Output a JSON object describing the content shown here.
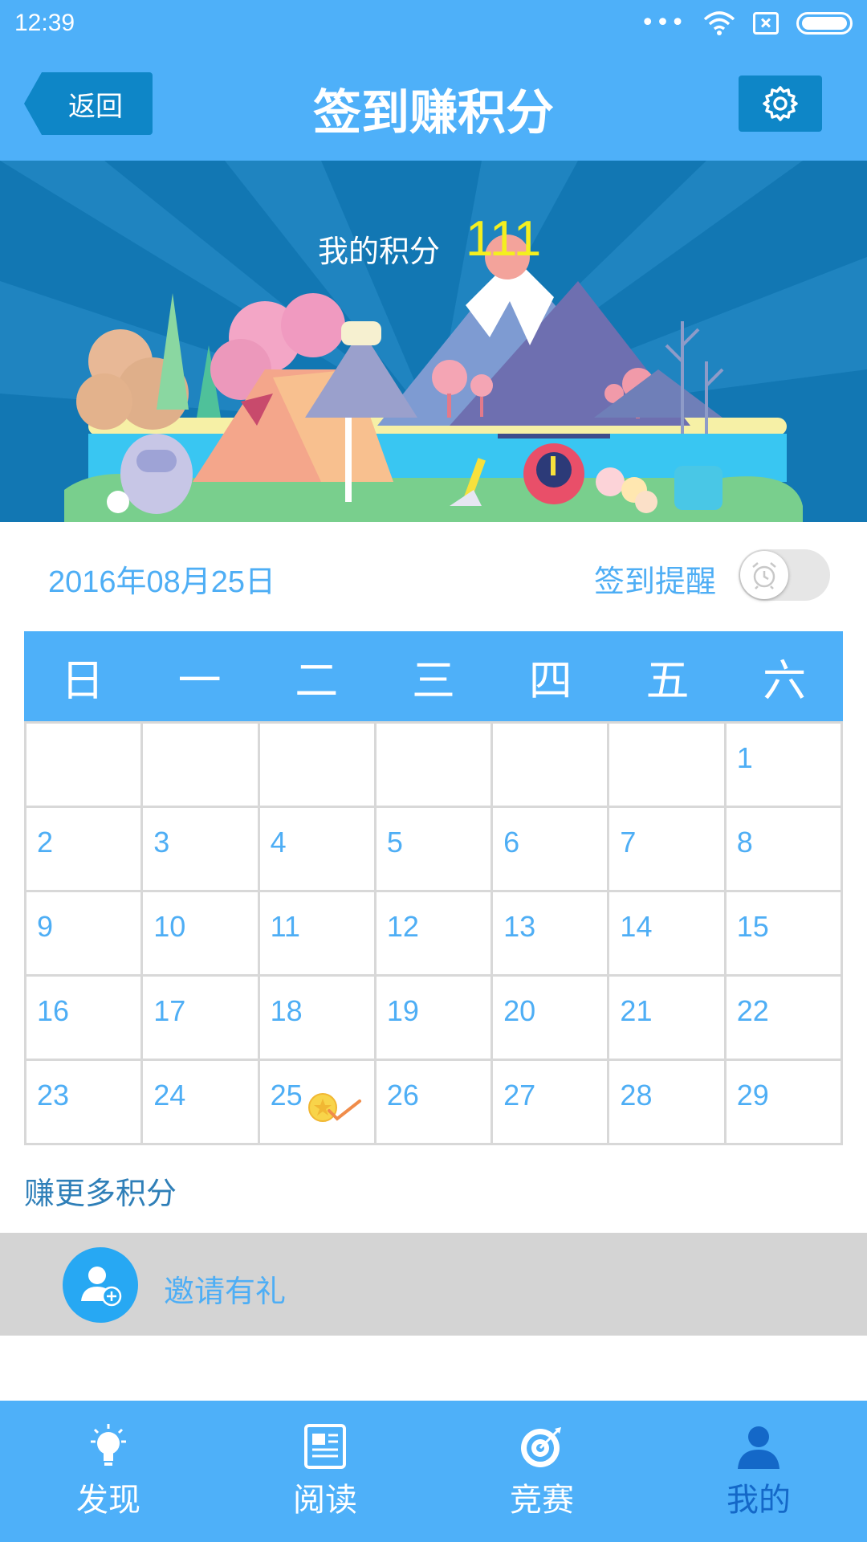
{
  "status_bar": {
    "time": "12:39",
    "dots": "•••"
  },
  "header": {
    "back_label": "返回",
    "title": "签到赚积分"
  },
  "banner": {
    "points_label": "我的积分",
    "points_value": "111"
  },
  "date": "2016年08月25日",
  "reminder": {
    "label": "签到提醒",
    "enabled": false
  },
  "calendar": {
    "weekdays": [
      "日",
      "一",
      "二",
      "三",
      "四",
      "五",
      "六"
    ],
    "cells": [
      "",
      "",
      "",
      "",
      "",
      "",
      "1",
      "2",
      "3",
      "4",
      "5",
      "6",
      "7",
      "8",
      "9",
      "10",
      "11",
      "12",
      "13",
      "14",
      "15",
      "16",
      "17",
      "18",
      "19",
      "20",
      "21",
      "22",
      "23",
      "24",
      "25",
      "26",
      "27",
      "28",
      "29"
    ],
    "checked_day": "25"
  },
  "earn_more": {
    "title": "赚更多积分",
    "invite_label": "邀请有礼"
  },
  "nav": [
    {
      "label": "发现",
      "icon": "lightbulb-icon",
      "active": false
    },
    {
      "label": "阅读",
      "icon": "newspaper-icon",
      "active": false
    },
    {
      "label": "竞赛",
      "icon": "target-icon",
      "active": false
    },
    {
      "label": "我的",
      "icon": "user-icon",
      "active": true
    }
  ],
  "colors": {
    "primary": "#4eb0f9",
    "dark_button": "#0e86c7",
    "text_blue": "#4eaef5",
    "points_yellow": "#f4ef1f",
    "active_nav": "#1468c8"
  }
}
